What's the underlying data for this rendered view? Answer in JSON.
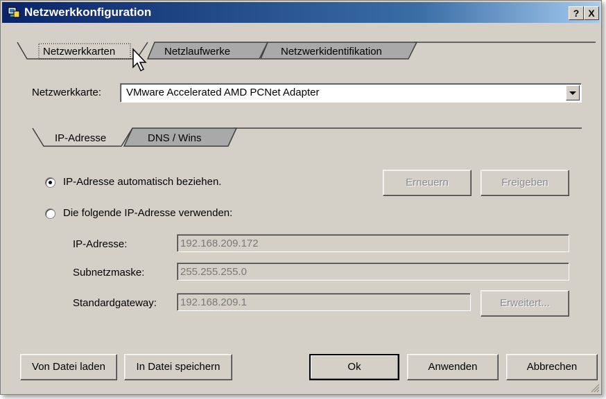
{
  "window": {
    "title": "Netzwerkkonfiguration",
    "help_label": "?",
    "close_label": "X"
  },
  "tabs": [
    {
      "label": "Netzwerkkarten",
      "active": true
    },
    {
      "label": "Netzlaufwerke",
      "active": false
    },
    {
      "label": "Netzwerkidentifikation",
      "active": false
    }
  ],
  "adapter": {
    "label": "Netzwerkkarte:",
    "value": "VMware Accelerated AMD PCNet Adapter"
  },
  "subtabs": [
    {
      "label": "IP-Adresse",
      "active": true
    },
    {
      "label": "DNS / Wins",
      "active": false
    }
  ],
  "ip": {
    "auto_label": "IP-Adresse automatisch beziehen.",
    "auto_selected": true,
    "manual_label": "Die folgende IP-Adresse verwenden:",
    "renew_label": "Erneuern",
    "release_label": "Freigeben",
    "address_label": "IP-Adresse:",
    "address_value": "192.168.209.172",
    "subnet_label": "Subnetzmaske:",
    "subnet_value": "255.255.255.0",
    "gateway_label": "Standardgateway:",
    "gateway_value": "192.168.209.1",
    "advanced_label": "Erweitert..."
  },
  "footer": {
    "load_label": "Von Datei laden",
    "save_label": "In Datei speichern",
    "ok_label": "Ok",
    "apply_label": "Anwenden",
    "cancel_label": "Abbrechen"
  }
}
